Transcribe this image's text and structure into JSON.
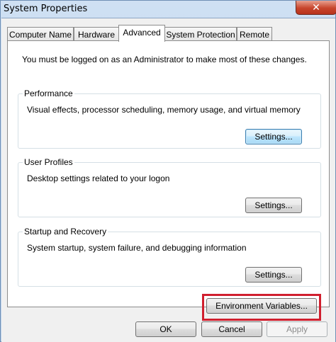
{
  "window": {
    "title": "System Properties",
    "close_glyph": "✕"
  },
  "tabs": [
    {
      "label": "Computer Name"
    },
    {
      "label": "Hardware"
    },
    {
      "label": "Advanced"
    },
    {
      "label": "System Protection"
    },
    {
      "label": "Remote"
    }
  ],
  "intro": "You must be logged on as an Administrator to make most of these changes.",
  "groups": {
    "performance": {
      "label": "Performance",
      "description": "Visual effects, processor scheduling, memory usage, and virtual memory",
      "button": "Settings..."
    },
    "user_profiles": {
      "label": "User Profiles",
      "description": "Desktop settings related to your logon",
      "button": "Settings..."
    },
    "startup": {
      "label": "Startup and Recovery",
      "description": "System startup, system failure, and debugging information",
      "button": "Settings..."
    }
  },
  "env_button": "Environment Variables...",
  "footer": {
    "ok": "OK",
    "cancel": "Cancel",
    "apply": "Apply"
  },
  "colors": {
    "highlight": "#d01f2e",
    "close": "#c7452c"
  }
}
